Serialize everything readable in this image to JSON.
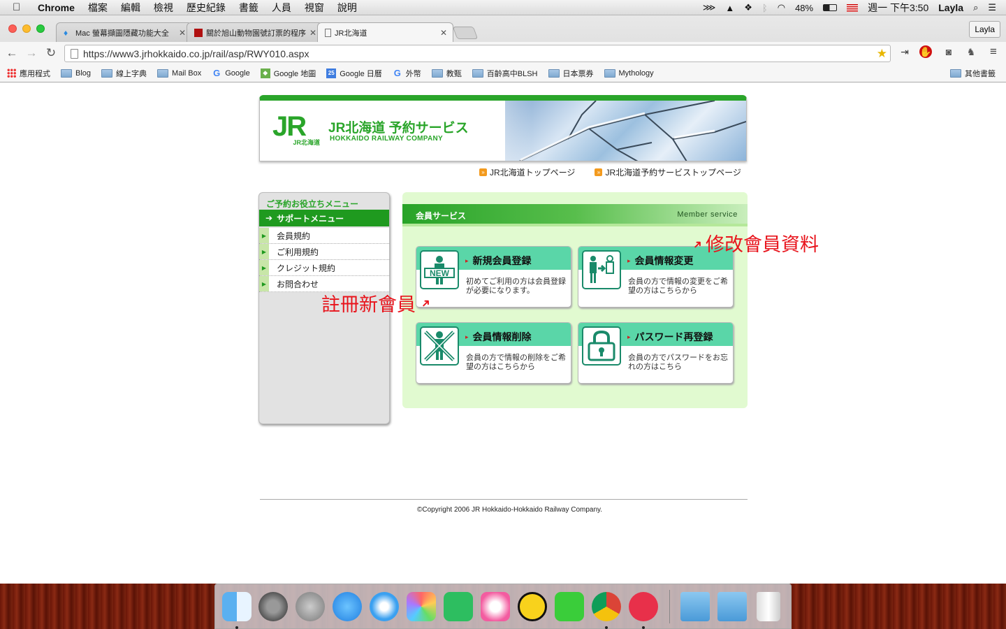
{
  "menubar": {
    "app_name": "Chrome",
    "menus": [
      "檔案",
      "編輯",
      "檢視",
      "歷史紀錄",
      "書籤",
      "人員",
      "視窗",
      "說明"
    ],
    "battery": "48%",
    "clock": "週一 下午3:50",
    "user": "Layla"
  },
  "browser": {
    "tabs": [
      {
        "title": "Mac 螢幕擷圖隱藏功能大全",
        "active": false
      },
      {
        "title": "關於旭山動物園號訂票的程序",
        "active": false
      },
      {
        "title": "JR北海道",
        "active": true
      }
    ],
    "profile": "Layla",
    "url": "https://www3.jrhokkaido.co.jp/rail/asp/RWY010.aspx",
    "bookmarks": [
      {
        "label": "應用程式",
        "icon": "apps-icon"
      },
      {
        "label": "Blog",
        "icon": "folder-icon"
      },
      {
        "label": "線上字典",
        "icon": "folder-icon"
      },
      {
        "label": "Mail Box",
        "icon": "folder-icon"
      },
      {
        "label": "Google",
        "icon": "google-icon"
      },
      {
        "label": "Google 地圖",
        "icon": "maps-icon"
      },
      {
        "label": "Google 日曆",
        "icon": "calendar-icon"
      },
      {
        "label": "外幣",
        "icon": "google-icon"
      },
      {
        "label": "教甄",
        "icon": "folder-icon"
      },
      {
        "label": "百齡高中BLSH",
        "icon": "folder-icon"
      },
      {
        "label": "日本票券",
        "icon": "folder-icon"
      },
      {
        "label": "Mythology",
        "icon": "folder-icon"
      }
    ],
    "other_bookmarks": "其他書籤"
  },
  "site": {
    "title": "JR北海道 予約サービス",
    "subtitle": "HOKKAIDO RAILWAY COMPANY",
    "logo_text": "JR",
    "logo_sub": "JR北海道",
    "top_links": [
      "JR北海道トップページ",
      "JR北海道予約サービストップページ"
    ],
    "sidebar": {
      "title": "ご予約お役立ちメニュー",
      "section": "サポートメニュー",
      "items": [
        "会員規約",
        "ご利用規約",
        "クレジット規約",
        "お問合わせ"
      ]
    },
    "member": {
      "title": "会員サービス",
      "title_en": "Member service",
      "cards": [
        {
          "name": "新規会員登録",
          "desc": "初めてご利用の方は会員登録が必要になります。",
          "icon": "new-member-icon"
        },
        {
          "name": "会員情報変更",
          "desc": "会員の方で情報の変更をご希望の方はこちらから",
          "icon": "change-info-icon"
        },
        {
          "name": "会員情報削除",
          "desc": "会員の方で情報の削除をご希望の方はこちらから",
          "icon": "delete-info-icon"
        },
        {
          "name": "パスワード再登録",
          "desc": "会員の方でパスワードをお忘れの方はこちら",
          "icon": "password-lock-icon"
        }
      ]
    },
    "annotations": {
      "register": "註冊新會員",
      "modify": "修改會員資料"
    },
    "copyright": "©Copyright 2006 JR Hokkaido-Hokkaido Railway Company."
  },
  "dock": [
    "finder-icon",
    "system-preferences-icon",
    "launchpad-icon",
    "app-store-icon",
    "safari-icon",
    "photos-icon",
    "evernote-icon",
    "itunes-icon",
    "money-icon",
    "line-icon",
    "chrome-icon",
    "skitch-icon",
    "applications-folder-icon",
    "downloads-folder-icon",
    "trash-icon"
  ]
}
